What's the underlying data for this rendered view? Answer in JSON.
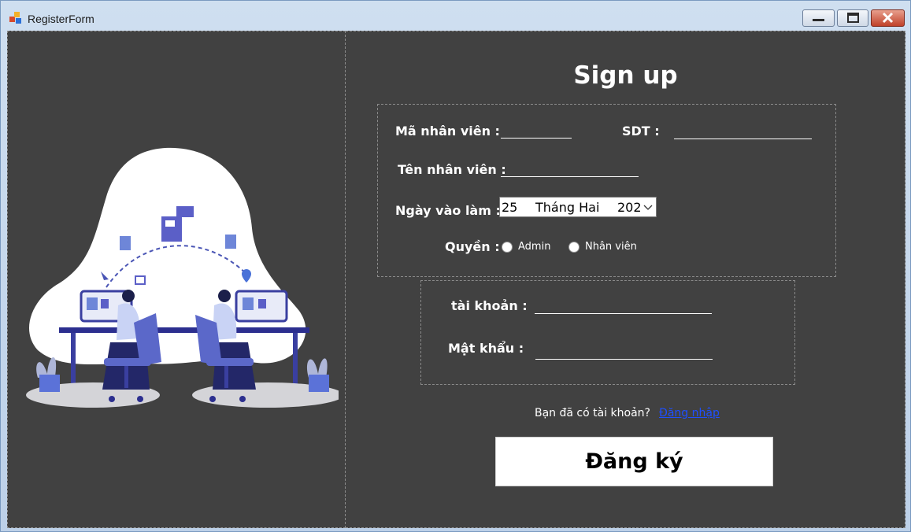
{
  "window": {
    "title": "RegisterForm",
    "controls": {
      "minimize": "minimize-icon",
      "maximize": "maximize-icon",
      "close": "close-icon"
    }
  },
  "illustration": {
    "description_icon": "two-people-working-at-computers-illustration"
  },
  "form": {
    "heading": "Sign up",
    "employee_id_label": "Mã nhân viên :",
    "employee_id_value": "",
    "phone_label": "SDT :",
    "phone_value": "",
    "employee_name_label": "Tên nhân viên :",
    "employee_name_value": "",
    "start_date_label": "Ngày vào làm :",
    "start_date": {
      "day": "25",
      "month": "Tháng Hai",
      "year": "202"
    },
    "role_label": "Quyền :",
    "role_options": [
      "Admin",
      "Nhân viên"
    ],
    "role_selected": null,
    "account_label": "tài khoản :",
    "account_value": "",
    "password_label": "Mật khẩu :",
    "password_value": ""
  },
  "footer": {
    "have_account_text": "Bạn đã có tài khoản?",
    "login_link": "Đăng nhập",
    "register_button": "Đăng ký"
  },
  "colors": {
    "panel_bg": "#414141",
    "accent_purple": "#5b5fc7",
    "link": "#1f4fff",
    "titlebar": "#cfdff0"
  }
}
